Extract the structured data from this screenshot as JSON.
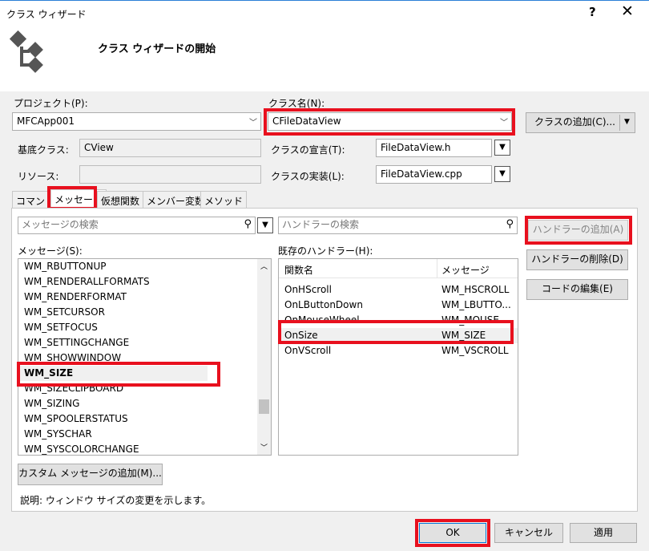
{
  "window": {
    "title": "クラス ウィザード",
    "help_label": "?",
    "close_label": "✕"
  },
  "header": {
    "heading": "クラス ウィザードの開始",
    "icon": "class-hierarchy-icon"
  },
  "project": {
    "label": "プロジェクト(P):",
    "value": "MFCApp001"
  },
  "class_name": {
    "label": "クラス名(N):",
    "value": "CFileDataView"
  },
  "add_class_button": "クラスの追加(C)...",
  "base_class": {
    "label": "基底クラス:",
    "value": "CView"
  },
  "resource": {
    "label": "リソース:",
    "value": ""
  },
  "class_decl": {
    "label": "クラスの宣言(T):",
    "value": "FileDataView.h"
  },
  "class_impl": {
    "label": "クラスの実装(L):",
    "value": "FileDataView.cpp"
  },
  "tabs": [
    "コマンド",
    "メッセージ",
    "仮想関数",
    "メンバー変数",
    "メソッド"
  ],
  "active_tab": "メッセージ",
  "messages": {
    "search_placeholder": "メッセージの検索",
    "label": "メッセージ(S):",
    "items": [
      "WM_RBUTTONUP",
      "WM_RENDERALLFORMATS",
      "WM_RENDERFORMAT",
      "WM_SETCURSOR",
      "WM_SETFOCUS",
      "WM_SETTINGCHANGE",
      "WM_SHOWWINDOW",
      "WM_SIZE",
      "WM_SIZECLIPBOARD",
      "WM_SIZING",
      "WM_SPOOLERSTATUS",
      "WM_SYSCHAR",
      "WM_SYSCOLORCHANGE"
    ],
    "selected": "WM_SIZE"
  },
  "handlers": {
    "search_placeholder": "ハンドラーの検索",
    "label": "既存のハンドラー(H):",
    "columns": [
      "関数名",
      "メッセージ"
    ],
    "rows": [
      [
        "OnHScroll",
        "WM_HSCROLL"
      ],
      [
        "OnLButtonDown",
        "WM_LBUTTO..."
      ],
      [
        "OnMouseWheel",
        "WM_MOUSE..."
      ],
      [
        "OnSize",
        "WM_SIZE"
      ],
      [
        "OnVScroll",
        "WM_VSCROLL"
      ]
    ],
    "selected": "OnSize"
  },
  "add_handler_button": "ハンドラーの追加(A)",
  "delete_handler_button": "ハンドラーの削除(D)",
  "edit_code_button": "コードの編集(E)",
  "add_custom_message_button": "カスタム メッセージの追加(M)...",
  "description": "説明:  ウィンドウ サイズの変更を示します。",
  "footer": {
    "ok": "OK",
    "cancel": "キャンセル",
    "apply": "適用"
  },
  "colors": {
    "highlight": "#e8101e",
    "titlebar_accent": "#2b7fd6"
  }
}
